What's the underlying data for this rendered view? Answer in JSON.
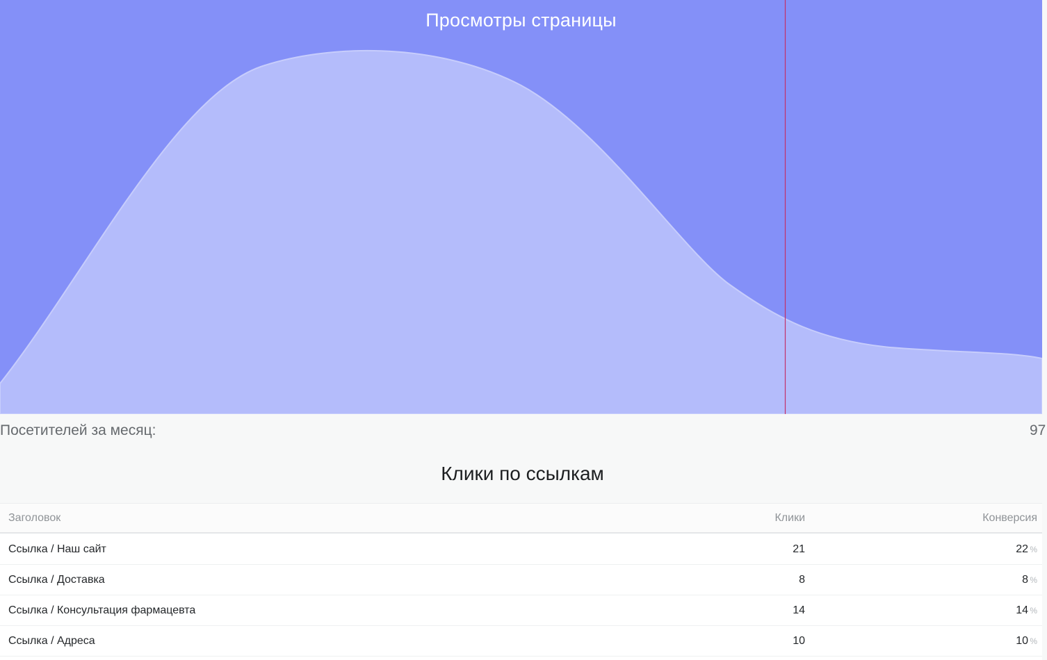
{
  "page_views": {
    "title": "Просмотры страницы",
    "colors": {
      "background": "#8490f8",
      "area_fill": "#b4bcfb",
      "area_stroke": "#c7cdfc",
      "cursor_line": "#c2306a"
    }
  },
  "visitors": {
    "label": "Посетителей за месяц:",
    "value": "97"
  },
  "link_clicks": {
    "title": "Клики по ссылкам",
    "columns": [
      "Заголовок",
      "Клики",
      "Конверсия"
    ],
    "percent_sign": "%",
    "rows": [
      {
        "title": "Ссылка / Наш сайт",
        "clicks": "21",
        "conversion": "22"
      },
      {
        "title": "Ссылка / Доставка",
        "clicks": "8",
        "conversion": "8"
      },
      {
        "title": "Ссылка / Консультация фармацевта",
        "clicks": "14",
        "conversion": "14"
      },
      {
        "title": "Ссылка / Адреса",
        "clicks": "10",
        "conversion": "10"
      }
    ]
  }
}
